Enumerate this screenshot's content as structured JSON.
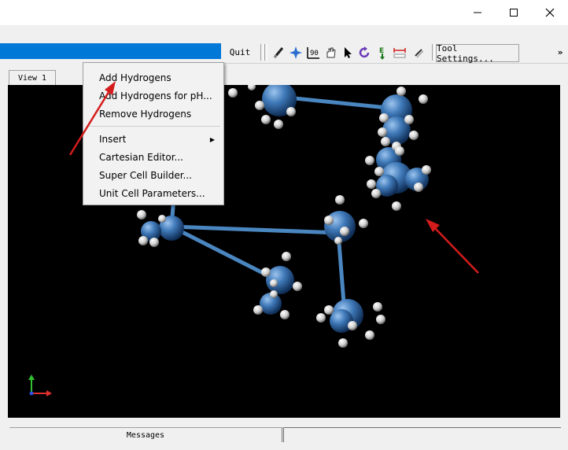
{
  "window": {
    "minimize_glyph": "—",
    "maximize_glyph": "☐",
    "close_glyph": "✕"
  },
  "toolbar": {
    "quit_label": "Quit",
    "tool_settings_label": "Tool Settings...",
    "overflow_label": "»",
    "icons": [
      "draw-icon",
      "navigate-icon",
      "align-icon",
      "drag-icon",
      "select-icon",
      "rotate-icon",
      "extrude-icon",
      "measure-icon",
      "bond-tool-icon"
    ],
    "icon_text_align": "90",
    "icon_text_extrude": "E"
  },
  "tabs": {
    "view_label": "View 1"
  },
  "context_menu": {
    "items": [
      {
        "label": "Add Hydrogens"
      },
      {
        "label": "Add Hydrogens for pH..."
      },
      {
        "label": "Remove Hydrogens"
      },
      {
        "label": "Insert"
      },
      {
        "label": "Cartesian Editor..."
      },
      {
        "label": "Super Cell Builder..."
      },
      {
        "label": "Unit Cell Parameters..."
      }
    ]
  },
  "messages": {
    "label": "Messages"
  },
  "colors": {
    "accent_blue": "#0078d7",
    "atom_carbon": "#3f79b8",
    "atom_hydrogen": "#e6e6e6",
    "bond": "#4a86c0",
    "arrow_red": "#d41c1c",
    "axis_x": "#e03030",
    "axis_y": "#30c030",
    "axis_z": "#3050e0"
  }
}
